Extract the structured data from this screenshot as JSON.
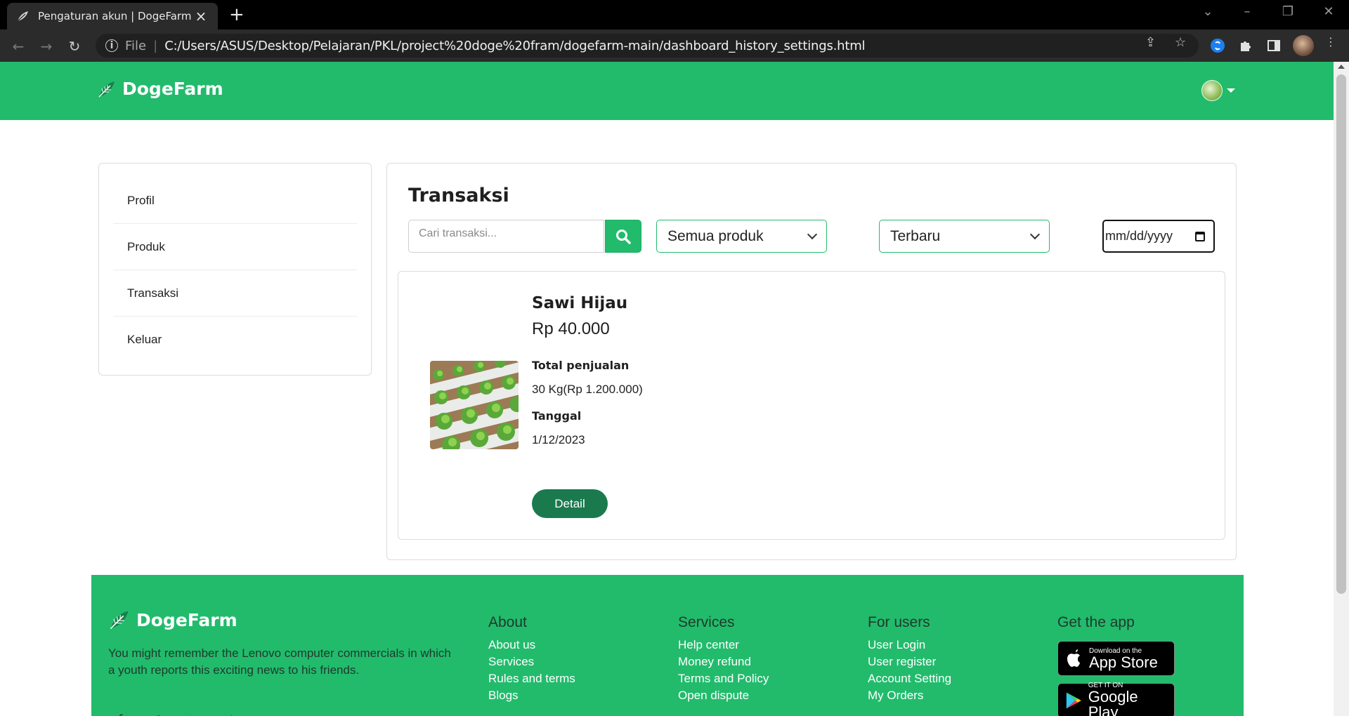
{
  "browser": {
    "tab_title": "Pengaturan akun | DogeFarm",
    "scheme": "File",
    "url": "C:/Users/ASUS/Desktop/Pelajaran/PKL/project%20doge%20fram/dogefarm-main/dashboard_history_settings.html"
  },
  "navbar": {
    "brand": "DogeFarm"
  },
  "sidebar": {
    "items": [
      {
        "label": "Profil"
      },
      {
        "label": "Produk"
      },
      {
        "label": "Transaksi"
      },
      {
        "label": "Keluar"
      }
    ]
  },
  "main": {
    "title": "Transaksi",
    "search_placeholder": "Cari transaksi...",
    "product_filter": "Semua produk",
    "sort_filter": "Terbaru",
    "date_placeholder": "mm/dd/yyyy"
  },
  "transaction": {
    "name": "Sawi Hijau",
    "price": "Rp 40.000",
    "total_label": "Total penjualan",
    "total_value": "30 Kg(Rp 1.200.000)",
    "date_label": "Tanggal",
    "date_value": "1/12/2023",
    "detail_button": "Detail"
  },
  "footer": {
    "brand": "DogeFarm",
    "description": "You might remember the Lenovo computer commercials in which a youth reports this exciting news to his friends.",
    "columns": [
      {
        "heading": "About",
        "links": [
          "About us",
          "Services",
          "Rules and terms",
          "Blogs"
        ]
      },
      {
        "heading": "Services",
        "links": [
          "Help center",
          "Money refund",
          "Terms and Policy",
          "Open dispute"
        ]
      },
      {
        "heading": "For users",
        "links": [
          "User Login",
          "User register",
          "Account Setting",
          "My Orders"
        ]
      }
    ],
    "app_heading": "Get the app",
    "app_store_small": "Download on the",
    "app_store_big": "App Store",
    "play_store_small": "GET IT ON",
    "play_store_big": "Google Play"
  },
  "colors": {
    "brand_green": "#22bb6c",
    "button_dark_green": "#1a7a4e"
  }
}
